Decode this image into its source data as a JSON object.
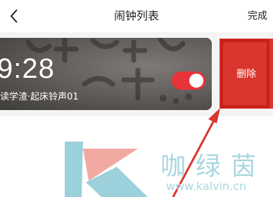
{
  "nav": {
    "back_icon": "chevron-left-icon",
    "title": "闹钟列表",
    "done_label": "完成"
  },
  "alarm": {
    "time": "9:28",
    "subtitle": "读学渣·起床铃声01",
    "enabled": true,
    "toggle_color": "#e8333a"
  },
  "actions": {
    "delete_label": "删除",
    "delete_color": "#d9362f"
  },
  "annotation": {
    "highlight_color": "#c8201b"
  },
  "watermark": {
    "brand": "咖绿茵",
    "url": "www.kalvin.cn"
  }
}
